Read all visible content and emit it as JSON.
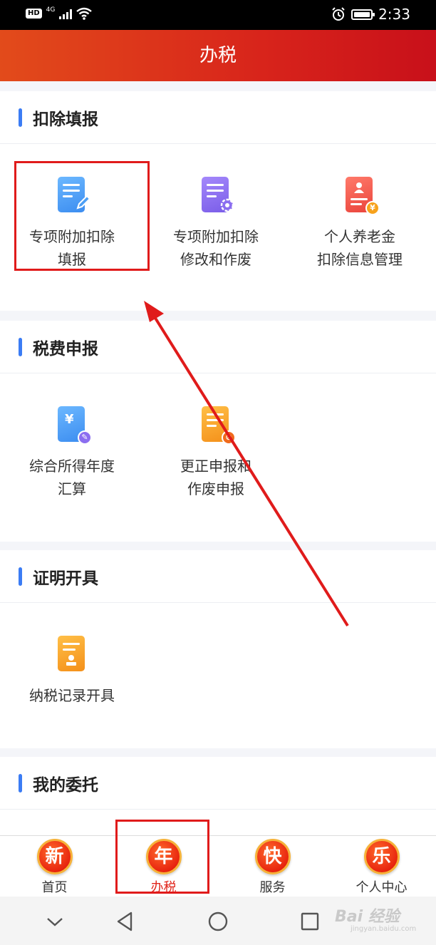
{
  "status_bar": {
    "hd": "HD",
    "network": "4G",
    "time": "2:33"
  },
  "header": {
    "title": "办税"
  },
  "sections": [
    {
      "title": "扣除填报",
      "items": [
        {
          "line1": "专项附加扣除",
          "line2": "填报",
          "icon": "document-edit-icon",
          "color": "#4d9ff5"
        },
        {
          "line1": "专项附加扣除",
          "line2": "修改和作废",
          "icon": "document-settings-icon",
          "color": "#8b6ef0"
        },
        {
          "line1": "个人养老金",
          "line2": "扣除信息管理",
          "icon": "pension-card-icon",
          "color": "#f05a52"
        }
      ]
    },
    {
      "title": "税费申报",
      "items": [
        {
          "line1": "综合所得年度",
          "line2": "汇算",
          "icon": "yuan-document-icon",
          "color": "#4d9ff5"
        },
        {
          "line1": "更正申报和",
          "line2": "作废申报",
          "icon": "document-cancel-icon",
          "color": "#f7a21c"
        }
      ]
    },
    {
      "title": "证明开具",
      "items": [
        {
          "line1": "纳税记录开具",
          "line2": "",
          "icon": "certificate-stamp-icon",
          "color": "#f7a21c"
        }
      ]
    },
    {
      "title": "我的委托",
      "items": []
    }
  ],
  "tabbar": {
    "tabs": [
      {
        "glyph": "新",
        "label": "首页"
      },
      {
        "glyph": "年",
        "label": "办税"
      },
      {
        "glyph": "快",
        "label": "服务"
      },
      {
        "glyph": "乐",
        "label": "个人中心"
      }
    ],
    "active_tab": "办税"
  },
  "watermark": {
    "brand": "Bai 经验",
    "url": "jingyan.baidu.com"
  },
  "colors": {
    "header_start": "#e24b1b",
    "header_end": "#c8101a",
    "accent_bar": "#3b7cf4",
    "highlight": "#e01b1b"
  }
}
